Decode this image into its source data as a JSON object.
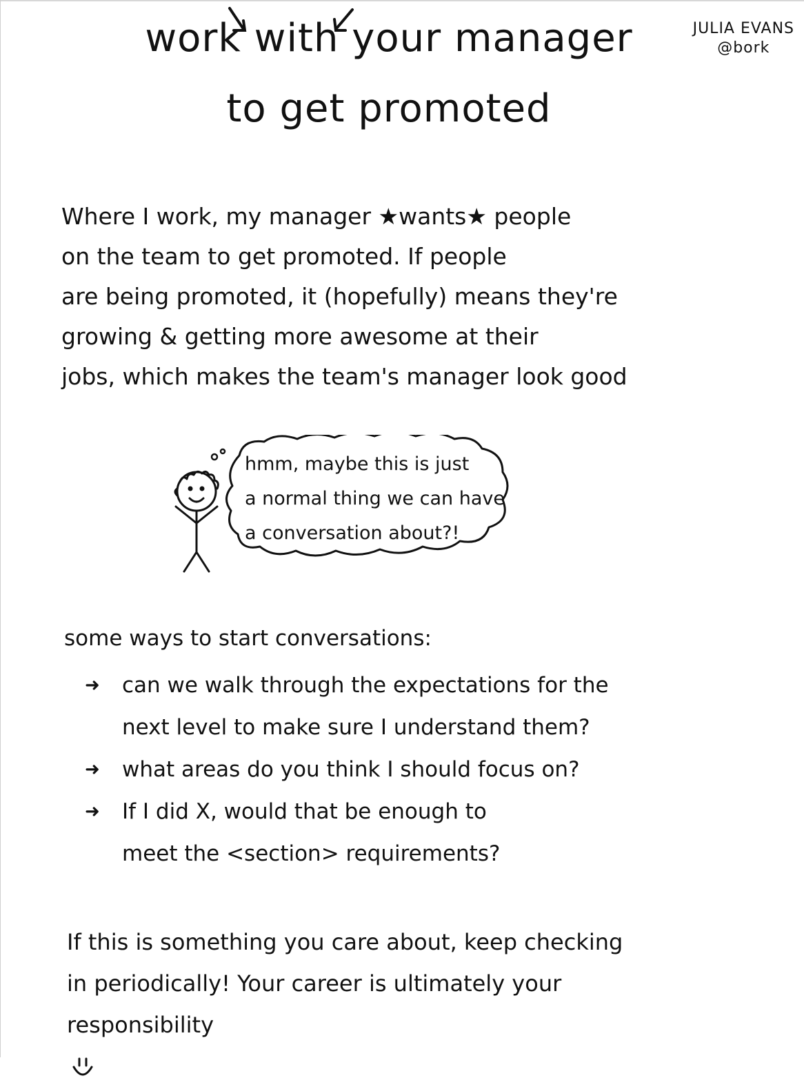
{
  "header": {
    "title_line1": "work with your manager",
    "title_line2": "to get promoted",
    "author_name": "JULIA EVANS",
    "author_handle": "@bork"
  },
  "intro": {
    "lines": [
      "Where I work, my manager ★wants★ people",
      "on the team to get promoted. If people",
      "are being promoted, it (hopefully) means they're",
      "growing & getting more awesome at their",
      "jobs, which makes the team's manager look good"
    ]
  },
  "thought_bubble": {
    "lines": [
      "hmm, maybe this is just",
      "a normal thing we can have",
      "a conversation about?!"
    ]
  },
  "ways": {
    "heading": "some ways to start conversations:",
    "arrow_glyph": "➜",
    "items": [
      {
        "line1": "can we walk through the expectations for the",
        "line2": "next level to make sure I understand them?"
      },
      {
        "line1": "what areas do you think I should focus on?",
        "line2": ""
      },
      {
        "line1": "If I did X, would that be enough to",
        "line2": "meet the <section> requirements?"
      }
    ]
  },
  "closing": {
    "lines": [
      "If this is something you care about, keep checking",
      "in periodically! Your career is ultimately your",
      "responsibility"
    ]
  }
}
